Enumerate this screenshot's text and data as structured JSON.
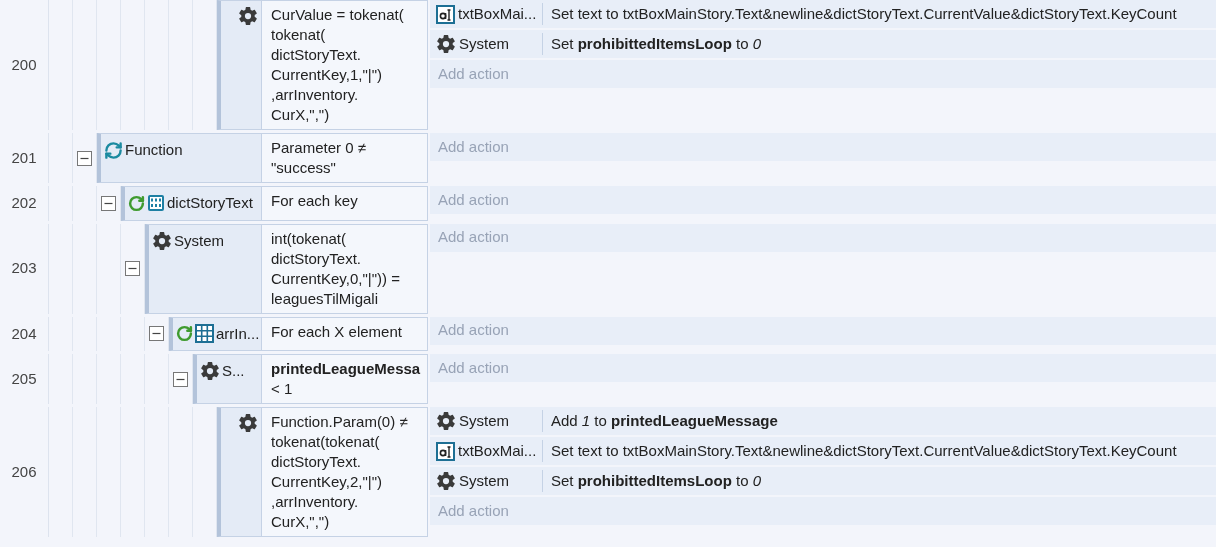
{
  "events": [
    {
      "children": [
        {
          "children": [
            {
              "children": [
                {
                  "children": [
                    {
                      "children": [
                        {
                          "line": "200",
                          "condition": {
                            "kind": "system",
                            "text": "CurValue = tokenat(\ntokenat(\ndictStoryText.\nCurrentKey,1,\"|\")\n,arrInventory.\nCurX,\",\")"
                          },
                          "actions": [
                            {
                              "kind": "textbox",
                              "object": "txtBoxMai...",
                              "text": "Set text to txtBoxMainStory.Text&newline&dictStoryText.CurrentValue&dictStoryText.KeyCount"
                            },
                            {
                              "kind": "system",
                              "object": "System",
                              "text": "Set **prohibittedItemsLoop** to *0*"
                            }
                          ],
                          "add_action": "Add action"
                        }
                      ]
                    }
                  ]
                }
              ]
            }
          ]
        }
      ]
    },
    {
      "line": "201",
      "expanded": true,
      "condition": {
        "kind": "function",
        "object": "Function",
        "text": "Parameter 0 ≠\n\"success\""
      },
      "add_action": "Add action",
      "children": [
        {
          "line": "202",
          "expanded": true,
          "condition": {
            "kind": "dictionary-loop",
            "object": "dictStoryText",
            "text": "For each key"
          },
          "add_action": "Add action",
          "children": [
            {
              "line": "203",
              "expanded": true,
              "condition": {
                "kind": "system",
                "object": "System",
                "text": "int(tokenat(\ndictStoryText.\nCurrentKey,0,\"|\")) =\nleaguesTilMigali"
              },
              "add_action": "Add action",
              "children": [
                {
                  "line": "204",
                  "expanded": true,
                  "condition": {
                    "kind": "array-loop",
                    "object": "arrIn...",
                    "text": "For each X element"
                  },
                  "add_action": "Add action",
                  "children": [
                    {
                      "line": "205",
                      "expanded": true,
                      "condition": {
                        "kind": "system",
                        "object": "S...",
                        "text": "**printedLeagueMessa**\n < 1"
                      },
                      "add_action": "Add action",
                      "children": [
                        {
                          "line": "206",
                          "condition": {
                            "kind": "system",
                            "text": "Function.Param(0) ≠\ntokenat(tokenat(\ndictStoryText.\nCurrentKey,2,\"|\")\n,arrInventory.\nCurX,\",\")"
                          },
                          "actions": [
                            {
                              "kind": "system",
                              "object": "System",
                              "text": "Add *1* to **printedLeagueMessage**"
                            },
                            {
                              "kind": "textbox",
                              "object": "txtBoxMai...",
                              "text": "Set text to txtBoxMainStory.Text&newline&dictStoryText.CurrentValue&dictStoryText.KeyCount"
                            },
                            {
                              "kind": "system",
                              "object": "System",
                              "text": "Set **prohibittedItemsLoop** to *0*"
                            }
                          ],
                          "add_action": "Add action"
                        }
                      ]
                    }
                  ]
                }
              ]
            }
          ]
        }
      ]
    }
  ]
}
